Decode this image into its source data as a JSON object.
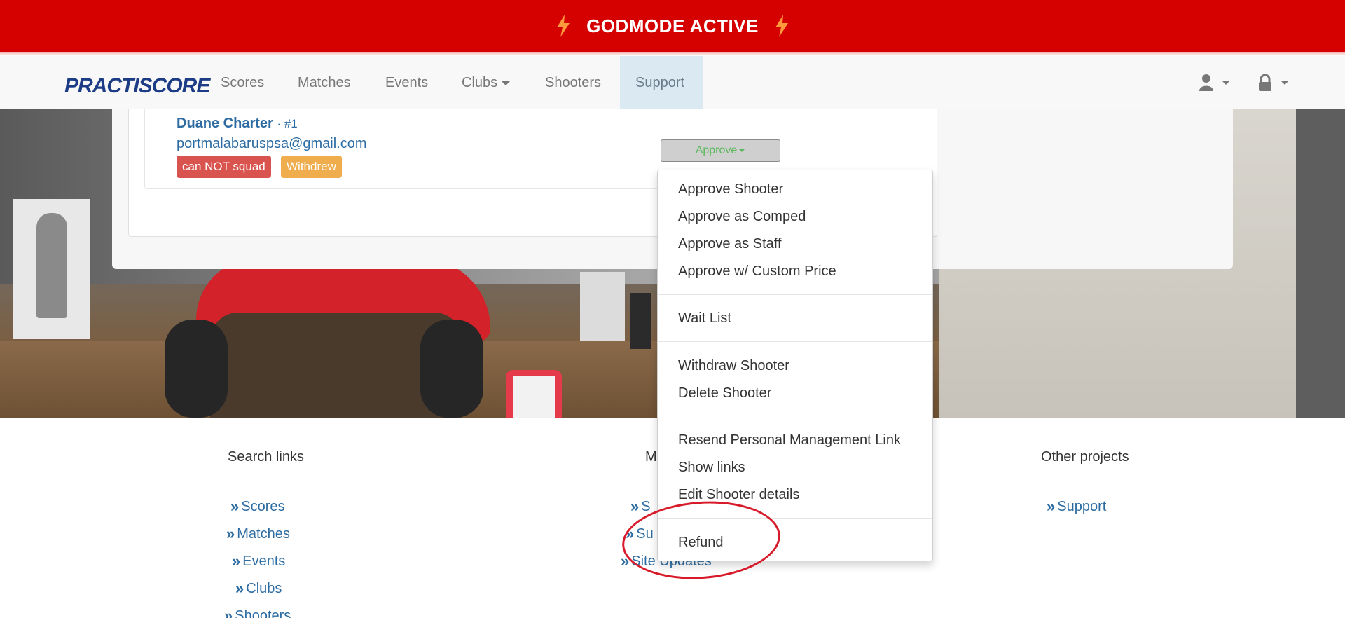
{
  "banner": {
    "title": "GODMODE ACTIVE"
  },
  "brand": {
    "logo_text": "PRACTISCORE"
  },
  "nav": {
    "items": [
      "Scores",
      "Matches",
      "Events",
      "Clubs",
      "Shooters",
      "Support"
    ],
    "active": "Support"
  },
  "shooter": {
    "name": "Duane Charter",
    "number": "· #1",
    "email": "portmalabaruspsa@gmail.com",
    "badges": [
      "can NOT squad",
      "Withdrew"
    ]
  },
  "approve_button": {
    "label": "Approve"
  },
  "menu": {
    "items": [
      "Approve Shooter",
      "Approve as Comped",
      "Approve as Staff",
      "Approve w/ Custom Price",
      "Wait List",
      "Withdraw Shooter",
      "Delete Shooter",
      "Resend Personal Management Link",
      "Show links",
      "Edit Shooter details",
      "Refund"
    ]
  },
  "footer": {
    "search_heading": "Search links",
    "middle_heading_partial": "M",
    "other_heading": "Other projects",
    "search_links": [
      "Scores",
      "Matches",
      "Events",
      "Clubs",
      "Shooters"
    ],
    "middle_links_partial": [
      "S",
      "Su",
      "Site Updates"
    ],
    "other_links": [
      "Support"
    ]
  },
  "colors": {
    "banner_red": "#d50000",
    "link_blue": "#2d6ca2",
    "badge_red": "#d9534f",
    "badge_orange": "#f0ad4e",
    "approve_green": "#5cb85c",
    "annotation_red": "#d81b2a"
  },
  "icons": {
    "banner": "lightning-bolt-icon",
    "user_menu": "user-icon",
    "lock_menu": "lock-icon",
    "footer_links": "double-chevron-right-icon"
  }
}
